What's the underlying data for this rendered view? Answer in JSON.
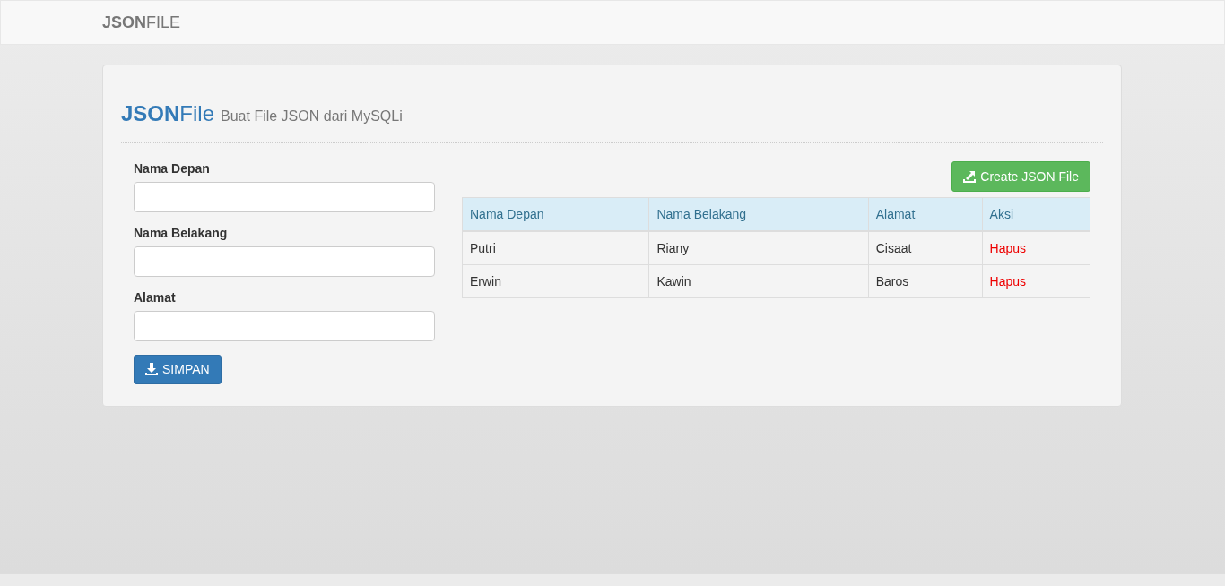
{
  "navbar": {
    "brand": "**JSON**FILE"
  },
  "header": {
    "title": "**JSON**File",
    "subtitle": "Buat File JSON dari MySQLi"
  },
  "form": {
    "fields": [
      {
        "label": "Nama Depan"
      },
      {
        "label": "Nama Belakang"
      },
      {
        "label": "Alamat"
      }
    ],
    "submit": "SIMPAN"
  },
  "create_button": "Create JSON File",
  "table": {
    "columns": [
      "Nama Depan",
      "Nama Belakang",
      "Alamat",
      "Aksi"
    ],
    "rows": [
      {
        "cells": [
          "Putri",
          "Riany",
          "Cisaat"
        ],
        "action": "Hapus"
      },
      {
        "cells": [
          "Erwin",
          "Kawin",
          "Baros"
        ],
        "action": "Hapus"
      }
    ]
  }
}
